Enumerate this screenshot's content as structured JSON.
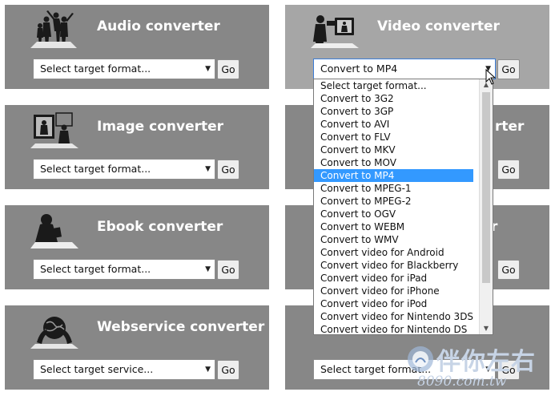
{
  "tiles": [
    {
      "id": "audio",
      "title": "Audio converter",
      "select": "Select target format...",
      "go": "Go",
      "icon": "people-silhouette-icon"
    },
    {
      "id": "video",
      "title": "Video converter",
      "select": "Convert to MP4",
      "go": "Go",
      "icon": "camera-operator-icon"
    },
    {
      "id": "image",
      "title": "Image converter",
      "select": "Select target format...",
      "go": "Go",
      "icon": "photo-silhouette-icon"
    },
    {
      "id": "right2",
      "title_partial": "rter",
      "select": "",
      "go": "Go"
    },
    {
      "id": "ebook",
      "title": "Ebook converter",
      "select": "Select target format...",
      "go": "Go",
      "icon": "reader-silhouette-icon"
    },
    {
      "id": "right3",
      "title_partial": "r",
      "select": "",
      "go": "Go"
    },
    {
      "id": "webservice",
      "title": "Webservice converter",
      "select": "Select target service...",
      "go": "Go",
      "icon": "globe-hands-icon"
    },
    {
      "id": "right4",
      "select": "Select target format...",
      "go": "Go"
    }
  ],
  "dropdown": {
    "options": [
      "Select target format...",
      "Convert to 3G2",
      "Convert to 3GP",
      "Convert to AVI",
      "Convert to FLV",
      "Convert to MKV",
      "Convert to MOV",
      "Convert to MP4",
      "Convert to MPEG-1",
      "Convert to MPEG-2",
      "Convert to OGV",
      "Convert to WEBM",
      "Convert to WMV",
      "Convert video for Android",
      "Convert video for Blackberry",
      "Convert video for iPad",
      "Convert video for iPhone",
      "Convert video for iPod",
      "Convert video for Nintendo 3DS",
      "Convert video for Nintendo DS"
    ],
    "selected_index": 7
  },
  "watermark": {
    "text_cn": "伴你左右",
    "text_url": "8090.com.tw"
  },
  "colors": {
    "tile": "#878787",
    "tile_active": "#a6a6a6",
    "highlight": "#3399ff"
  }
}
